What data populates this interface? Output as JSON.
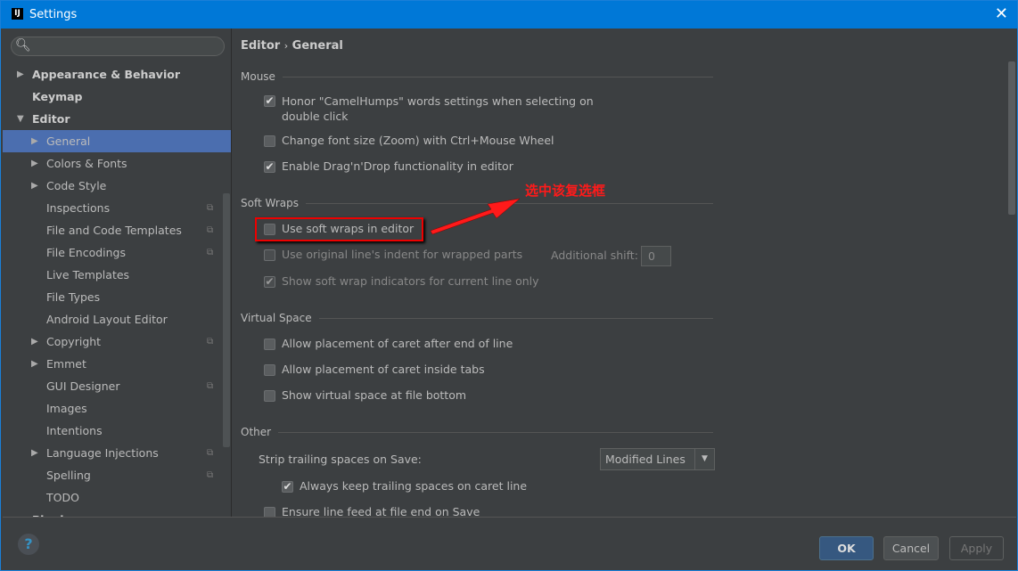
{
  "window": {
    "title": "Settings",
    "logo": "IJ",
    "close": "✕"
  },
  "search": {
    "placeholder": "",
    "icon": "search-icon"
  },
  "sidebar": {
    "items": [
      {
        "label": "Appearance & Behavior",
        "level": 0,
        "arrow": "▶",
        "bold": true
      },
      {
        "label": "Keymap",
        "level": 0,
        "arrow": "",
        "bold": true
      },
      {
        "label": "Editor",
        "level": 0,
        "arrow": "▼",
        "bold": true
      },
      {
        "label": "General",
        "level": 1,
        "arrow": "▶",
        "selected": true
      },
      {
        "label": "Colors & Fonts",
        "level": 1,
        "arrow": "▶"
      },
      {
        "label": "Code Style",
        "level": 1,
        "arrow": "▶"
      },
      {
        "label": "Inspections",
        "level": 1,
        "arrow": "",
        "copy": true
      },
      {
        "label": "File and Code Templates",
        "level": 1,
        "arrow": "",
        "copy": true
      },
      {
        "label": "File Encodings",
        "level": 1,
        "arrow": "",
        "copy": true
      },
      {
        "label": "Live Templates",
        "level": 1,
        "arrow": ""
      },
      {
        "label": "File Types",
        "level": 1,
        "arrow": ""
      },
      {
        "label": "Android Layout Editor",
        "level": 1,
        "arrow": ""
      },
      {
        "label": "Copyright",
        "level": 1,
        "arrow": "▶",
        "copy": true
      },
      {
        "label": "Emmet",
        "level": 1,
        "arrow": "▶"
      },
      {
        "label": "GUI Designer",
        "level": 1,
        "arrow": "",
        "copy": true
      },
      {
        "label": "Images",
        "level": 1,
        "arrow": ""
      },
      {
        "label": "Intentions",
        "level": 1,
        "arrow": ""
      },
      {
        "label": "Language Injections",
        "level": 1,
        "arrow": "▶",
        "copy": true
      },
      {
        "label": "Spelling",
        "level": 1,
        "arrow": "",
        "copy": true
      },
      {
        "label": "TODO",
        "level": 1,
        "arrow": ""
      },
      {
        "label": "Plugins",
        "level": 0,
        "arrow": "",
        "bold": true
      }
    ]
  },
  "breadcrumb": {
    "parent": "Editor",
    "sep": "›",
    "current": "General"
  },
  "sections": {
    "mouse": "Mouse",
    "soft_wraps": "Soft Wraps",
    "virtual_space": "Virtual Space",
    "other": "Other"
  },
  "options": {
    "camel_humps": {
      "label1": "Honor \"CamelHumps\" words settings when selecting on",
      "label2": "double click",
      "checked": true
    },
    "zoom": {
      "label": "Change font size (Zoom) with Ctrl+Mouse Wheel",
      "checked": false
    },
    "dnd": {
      "label": "Enable Drag'n'Drop functionality in editor",
      "checked": true
    },
    "soft_wraps": {
      "label": "Use soft wraps in editor",
      "checked": false
    },
    "orig_indent": {
      "label": "Use original line's indent for wrapped parts",
      "checked": false,
      "disabled": true
    },
    "indicators": {
      "label": "Show soft wrap indicators for current line only",
      "checked": true,
      "disabled": true
    },
    "caret_after_end": {
      "label": "Allow placement of caret after end of line",
      "checked": false
    },
    "caret_tabs": {
      "label": "Allow placement of caret inside tabs",
      "checked": false
    },
    "virtual_bottom": {
      "label": "Show virtual space at file bottom",
      "checked": false
    },
    "keep_trailing": {
      "label": "Always keep trailing spaces on caret line",
      "checked": true
    },
    "line_feed": {
      "label": "Ensure line feed at file end on Save",
      "checked": false
    }
  },
  "additional_shift": {
    "label": "Additional shift:",
    "value": "0"
  },
  "strip_trailing": {
    "label": "Strip trailing spaces on Save:",
    "value": "Modified Lines"
  },
  "annotation": {
    "text": "选中该复选框",
    "color": "#ff1a1a"
  },
  "buttons": {
    "ok": "OK",
    "cancel": "Cancel",
    "apply": "Apply",
    "help": "?"
  },
  "colors": {
    "titlebar": "#0078d7",
    "selection": "#4b6eaf",
    "background": "#3c3f41"
  }
}
